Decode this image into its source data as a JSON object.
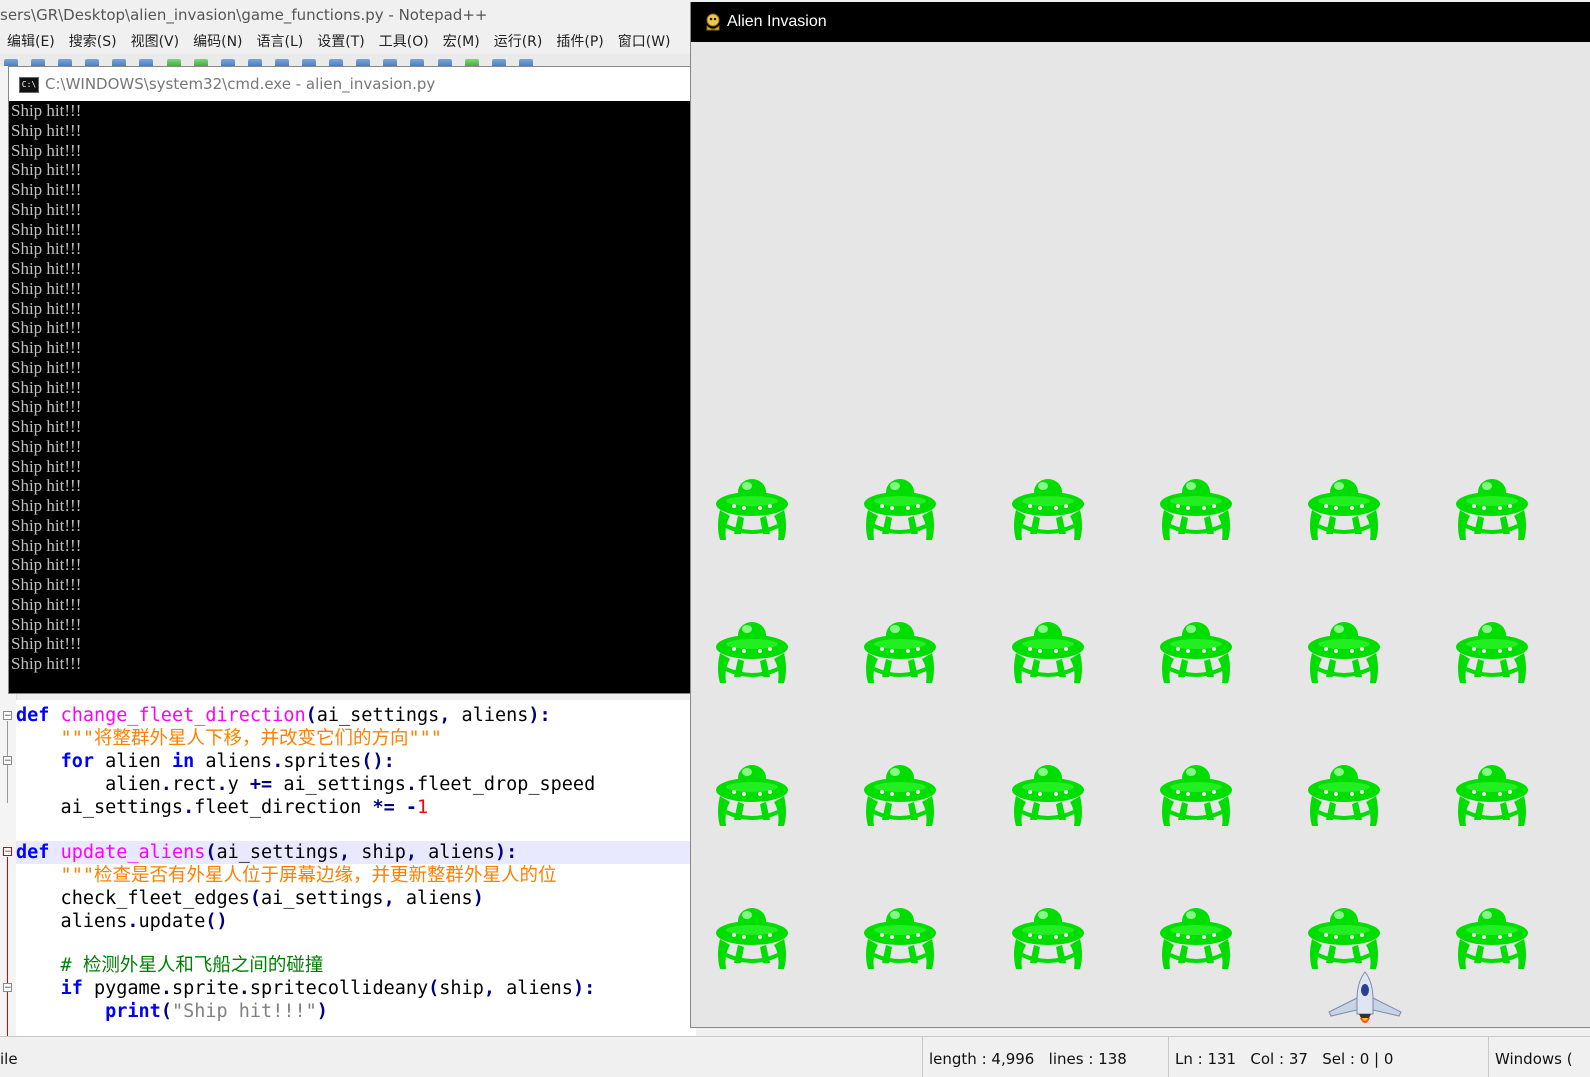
{
  "notepad": {
    "title": "sers\\GR\\Desktop\\alien_invasion\\game_functions.py - Notepad++",
    "menu": [
      "编辑(E)",
      "搜索(S)",
      "视图(V)",
      "编码(N)",
      "语言(L)",
      "设置(T)",
      "工具(O)",
      "宏(M)",
      "运行(R)",
      "插件(P)",
      "窗口(W)"
    ],
    "code": [
      "def change_fleet_direction(ai_settings, aliens):",
      "    \"\"\"将整群外星人下移，并改变它们的方向\"\"\"",
      "    for alien in aliens.sprites():",
      "        alien.rect.y += ai_settings.fleet_drop_speed",
      "    ai_settings.fleet_direction *= -1",
      "",
      "def update_aliens(ai_settings, ship, aliens):",
      "    \"\"\"检查是否有外星人位于屏幕边缘，并更新整群外星人的位",
      "    check_fleet_edges(ai_settings, aliens)",
      "    aliens.update()",
      "",
      "    # 检测外星人和飞船之间的碰撞",
      "    if pygame.sprite.spritecollideany(ship, aliens):",
      "        print(\"Ship hit!!!\")"
    ],
    "status": {
      "left": "ile",
      "length": "length : 4,996",
      "lines": "lines : 138",
      "ln": "Ln : 131",
      "col": "Col : 37",
      "sel": "Sel : 0 | 0",
      "eol": "Windows ("
    }
  },
  "cmd": {
    "title": "C:\\WINDOWS\\system32\\cmd.exe - alien_invasion.py",
    "icon": "cmd-icon",
    "lines": [
      "Ship hit!!!",
      "Ship hit!!!",
      "Ship hit!!!",
      "Ship hit!!!",
      "Ship hit!!!",
      "Ship hit!!!",
      "Ship hit!!!",
      "Ship hit!!!",
      "Ship hit!!!",
      "Ship hit!!!",
      "Ship hit!!!",
      "Ship hit!!!",
      "Ship hit!!!",
      "Ship hit!!!",
      "Ship hit!!!",
      "Ship hit!!!",
      "Ship hit!!!",
      "Ship hit!!!",
      "Ship hit!!!",
      "Ship hit!!!",
      "Ship hit!!!",
      "Ship hit!!!",
      "Ship hit!!!",
      "Ship hit!!!",
      "Ship hit!!!",
      "Ship hit!!!",
      "Ship hit!!!",
      "Ship hit!!!",
      "Ship hit!!!"
    ]
  },
  "game": {
    "title": "Alien Invasion",
    "icon": "pygame-snake-icon",
    "background": "#e6e6e6",
    "alien_color": "#00dd00",
    "alien_rows": 4,
    "alien_cols": 6,
    "ship_icon": "rocket-ship"
  }
}
